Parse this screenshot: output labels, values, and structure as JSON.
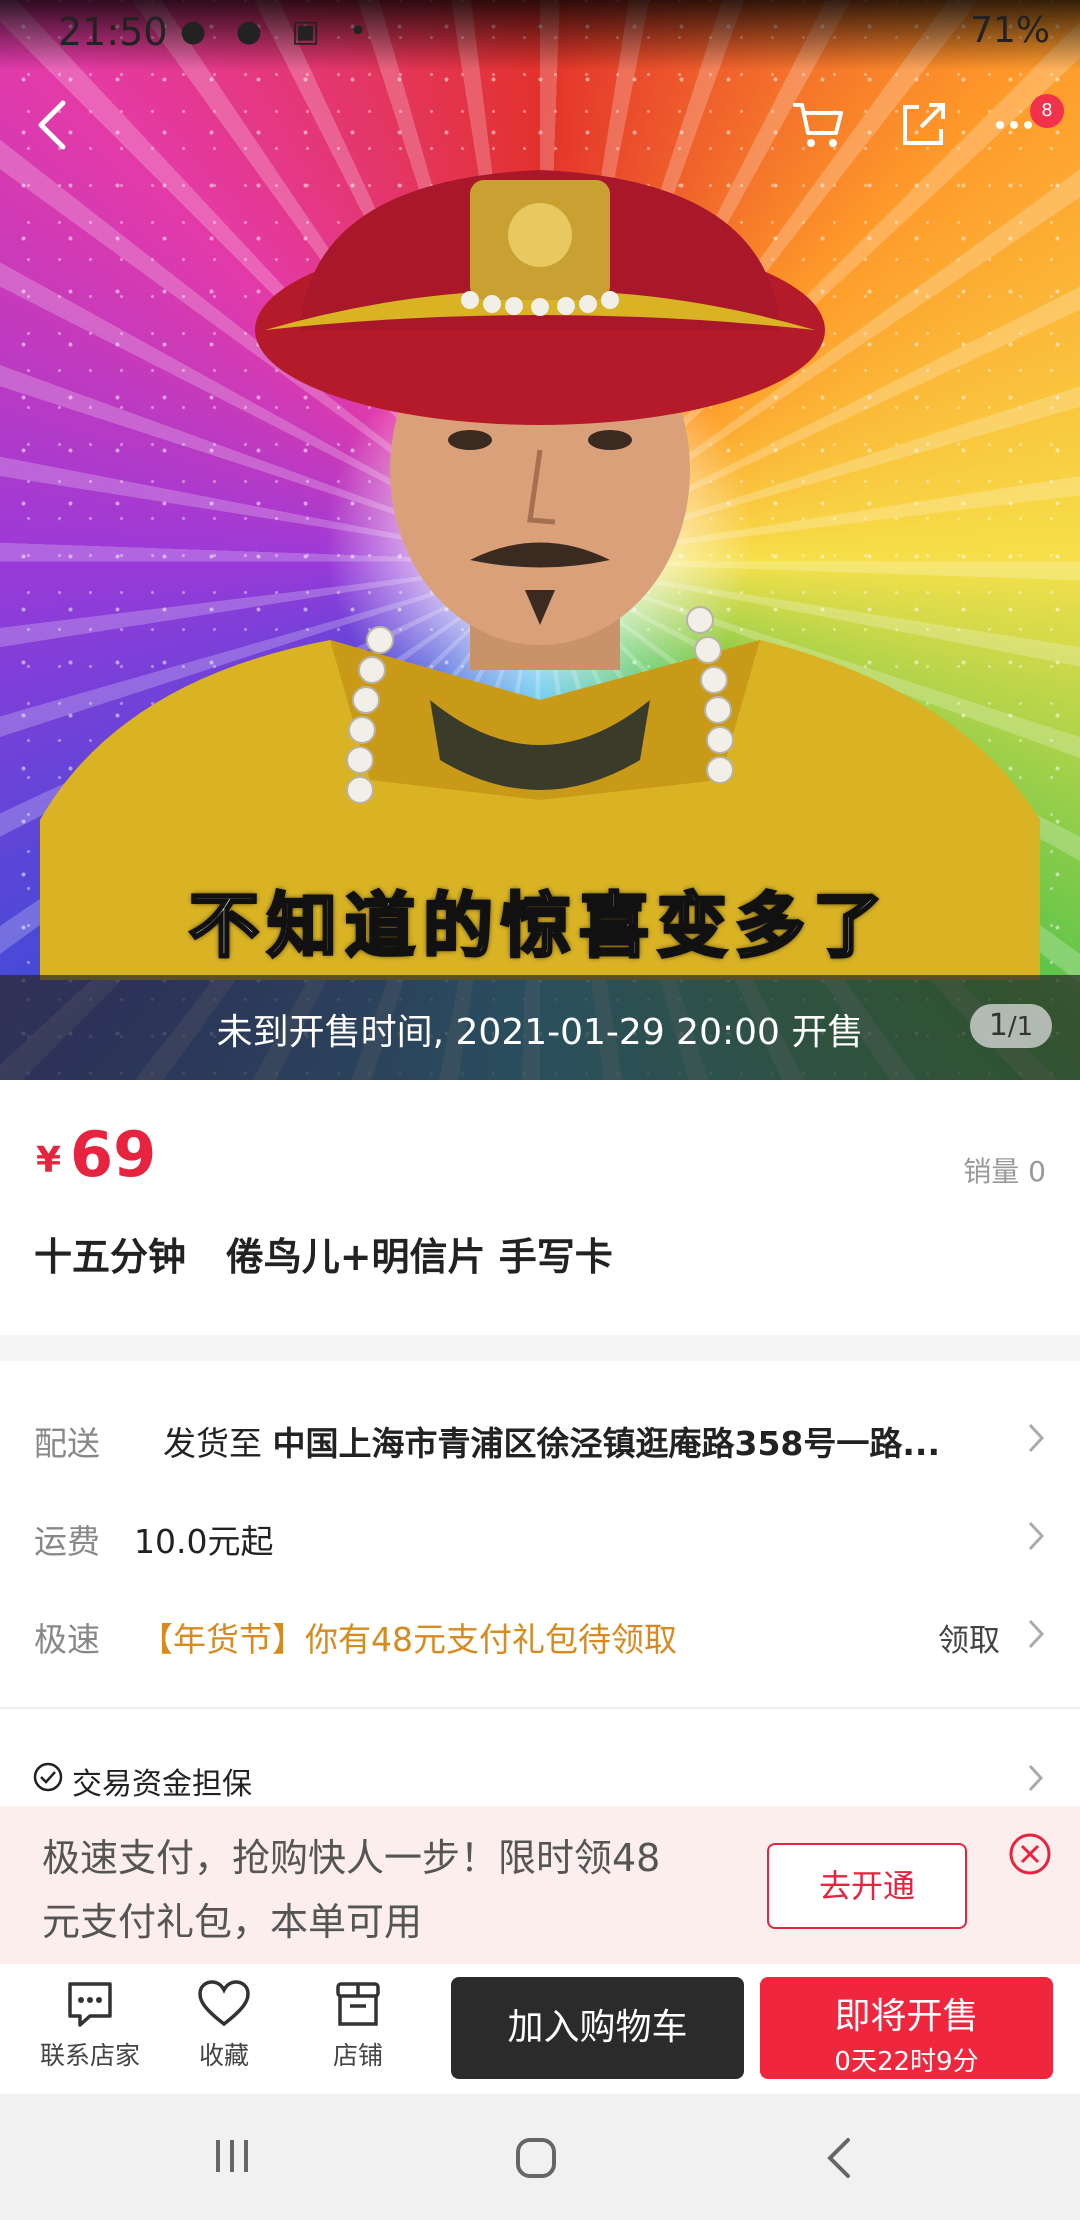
{
  "status_bar": {
    "time": "21:50",
    "battery": "71%"
  },
  "hero": {
    "caption": "不知道的惊喜变多了",
    "sale_notice": "未到开售时间, 2021-01-29 20:00 开售",
    "pager_current": "1",
    "pager_total": "/1"
  },
  "top_bar": {
    "more_badge": "8"
  },
  "product": {
    "currency": "¥",
    "price": "69",
    "sales": "销量 0",
    "title": "十五分钟   倦鸟儿+明信片 手写卡"
  },
  "rows": {
    "shipping_label": "配送",
    "shipping_prefix": "发货至 ",
    "shipping_address": "中国上海市青浦区徐泾镇逛庵路358号一路...",
    "fee_label": "运费",
    "fee_value": "10.0元起",
    "express_label": "极速",
    "express_value": "【年货节】你有48元支付礼包待领取",
    "express_action": "领取"
  },
  "guarantee": {
    "label": "交易资金担保"
  },
  "banner": {
    "message": "极速支付，抢购快人一步！限时领48元支付礼包，本单可用",
    "button": "去开通"
  },
  "action_bar": {
    "contact": "联系店家",
    "favorite": "收藏",
    "store": "店铺",
    "add_cart": "加入购物车",
    "sale_soon": "即将开售",
    "countdown": "0天22时9分"
  },
  "colors": {
    "accent": "#f0263e",
    "promo": "#d98a1e",
    "dark_button": "#2b2b2b"
  }
}
